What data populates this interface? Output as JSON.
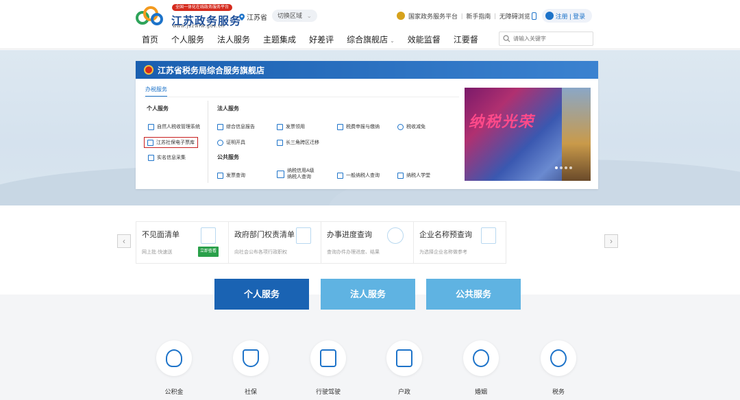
{
  "header": {
    "badge": "全国一体化在线政务服务平台",
    "site_title": "江苏政务服务",
    "site_url": "www.jszwfw.gov.cn",
    "location": "江苏省",
    "switch_region": "切换区域",
    "switch_caret": "⌄",
    "national_platform": "国家政务服务平台",
    "guide": "新手指南",
    "accessible": "无障碍浏览",
    "login": "注册 | 登录",
    "search_placeholder": "请输入关键字",
    "nav": [
      "首页",
      "个人服务",
      "法人服务",
      "主题集成",
      "好差评",
      "综合旗舰店",
      "效能监督",
      "江要督"
    ],
    "nav_caret": "⌄"
  },
  "card": {
    "title": "江苏省税务局综合服务旗舰店",
    "subtab": "办税服务",
    "personal_title": "个人服务",
    "corporate_title": "法人服务",
    "public_title": "公共服务",
    "personal": [
      "自然人税收管理系统",
      "江苏社保电子票库",
      "实名信息采集"
    ],
    "corporate": [
      "综合信息报告",
      "发票领用",
      "税费申报与缴纳",
      "税收减免",
      "证明开具",
      "长三角跨区迁移"
    ],
    "public": [
      "发票查询",
      "纳税信用A级",
      "纳税人查询",
      "一般纳税人查询",
      "纳税人学堂"
    ],
    "promo_text": "纳税光荣"
  },
  "quick": [
    {
      "title": "不见面清单",
      "desc": "网上批·快速送",
      "button": "立即查看"
    },
    {
      "title": "政府部门权责清单",
      "desc": "向社会公布各项行政职权"
    },
    {
      "title": "办事进度查询",
      "desc": "查询办件办理进度、结果"
    },
    {
      "title": "企业名称预查询",
      "desc": "为选择企业名称做参考"
    }
  ],
  "arrows": {
    "left": "‹",
    "right": "›"
  },
  "tabs": [
    "个人服务",
    "法人服务",
    "公共服务"
  ],
  "categories": [
    "公积金",
    "社保",
    "行驶驾驶",
    "户政",
    "婚姻",
    "税务"
  ]
}
